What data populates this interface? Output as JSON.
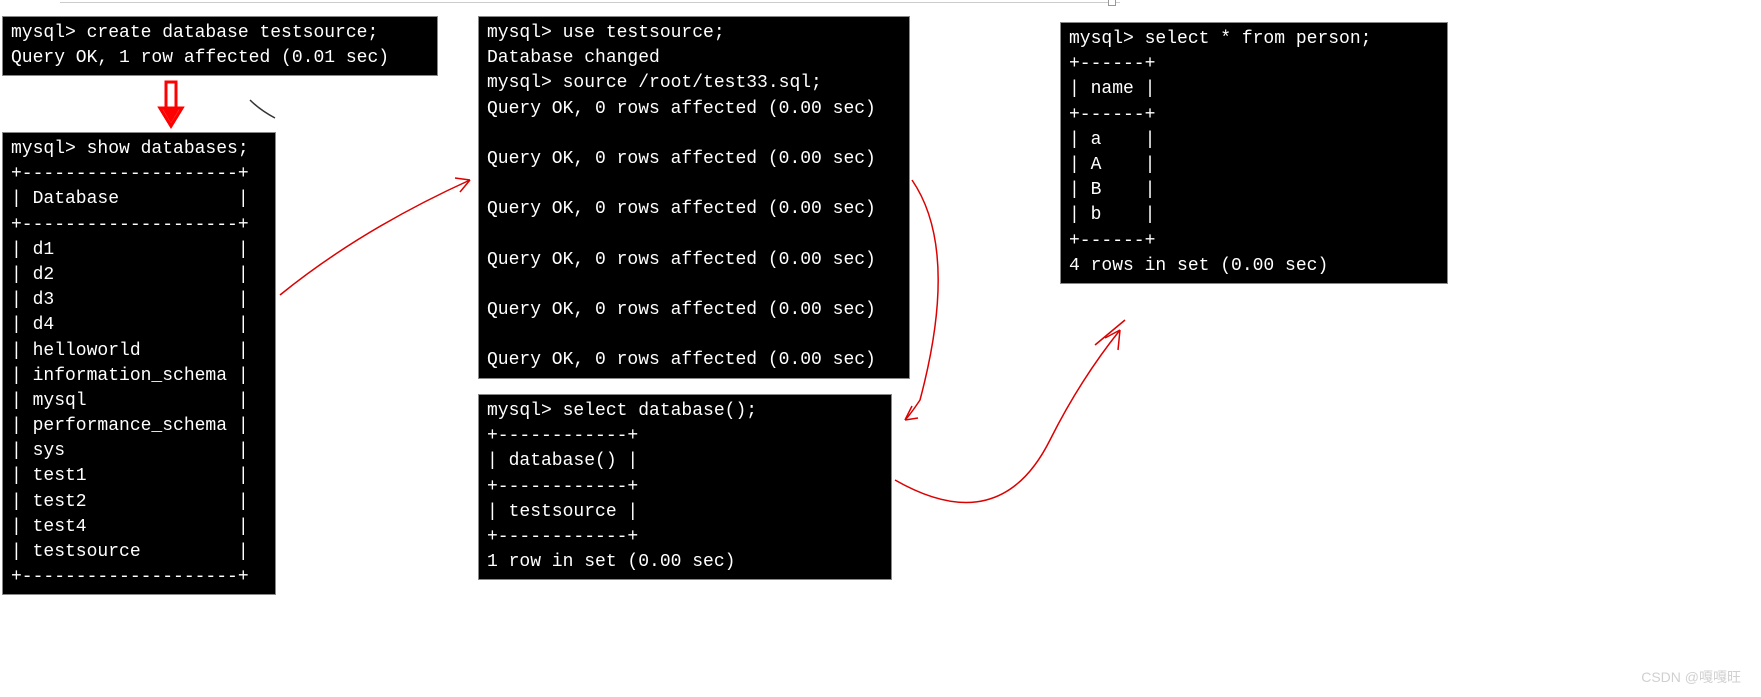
{
  "terminals": {
    "t1": {
      "content": "mysql> create database testsource;\nQuery OK, 1 row affected (0.01 sec)"
    },
    "t2": {
      "content": "mysql> show databases;\n+--------------------+\n| Database           |\n+--------------------+\n| d1                 |\n| d2                 |\n| d3                 |\n| d4                 |\n| helloworld         |\n| information_schema |\n| mysql              |\n| performance_schema |\n| sys                |\n| test1              |\n| test2              |\n| test4              |\n| testsource         |\n+--------------------+"
    },
    "t3": {
      "content": "mysql> use testsource;\nDatabase changed\nmysql> source /root/test33.sql;\nQuery OK, 0 rows affected (0.00 sec)\n\nQuery OK, 0 rows affected (0.00 sec)\n\nQuery OK, 0 rows affected (0.00 sec)\n\nQuery OK, 0 rows affected (0.00 sec)\n\nQuery OK, 0 rows affected (0.00 sec)\n\nQuery OK, 0 rows affected (0.00 sec)"
    },
    "t4": {
      "content": "mysql> select database();\n+------------+\n| database() |\n+------------+\n| testsource |\n+------------+\n1 row in set (0.00 sec)"
    },
    "t5": {
      "content": "mysql> select * from person;\n+------+\n| name |\n+------+\n| a    |\n| A    |\n| B    |\n| b    |\n+------+\n4 rows in set (0.00 sec)"
    }
  },
  "watermark": "CSDN @嘎嘎旺"
}
